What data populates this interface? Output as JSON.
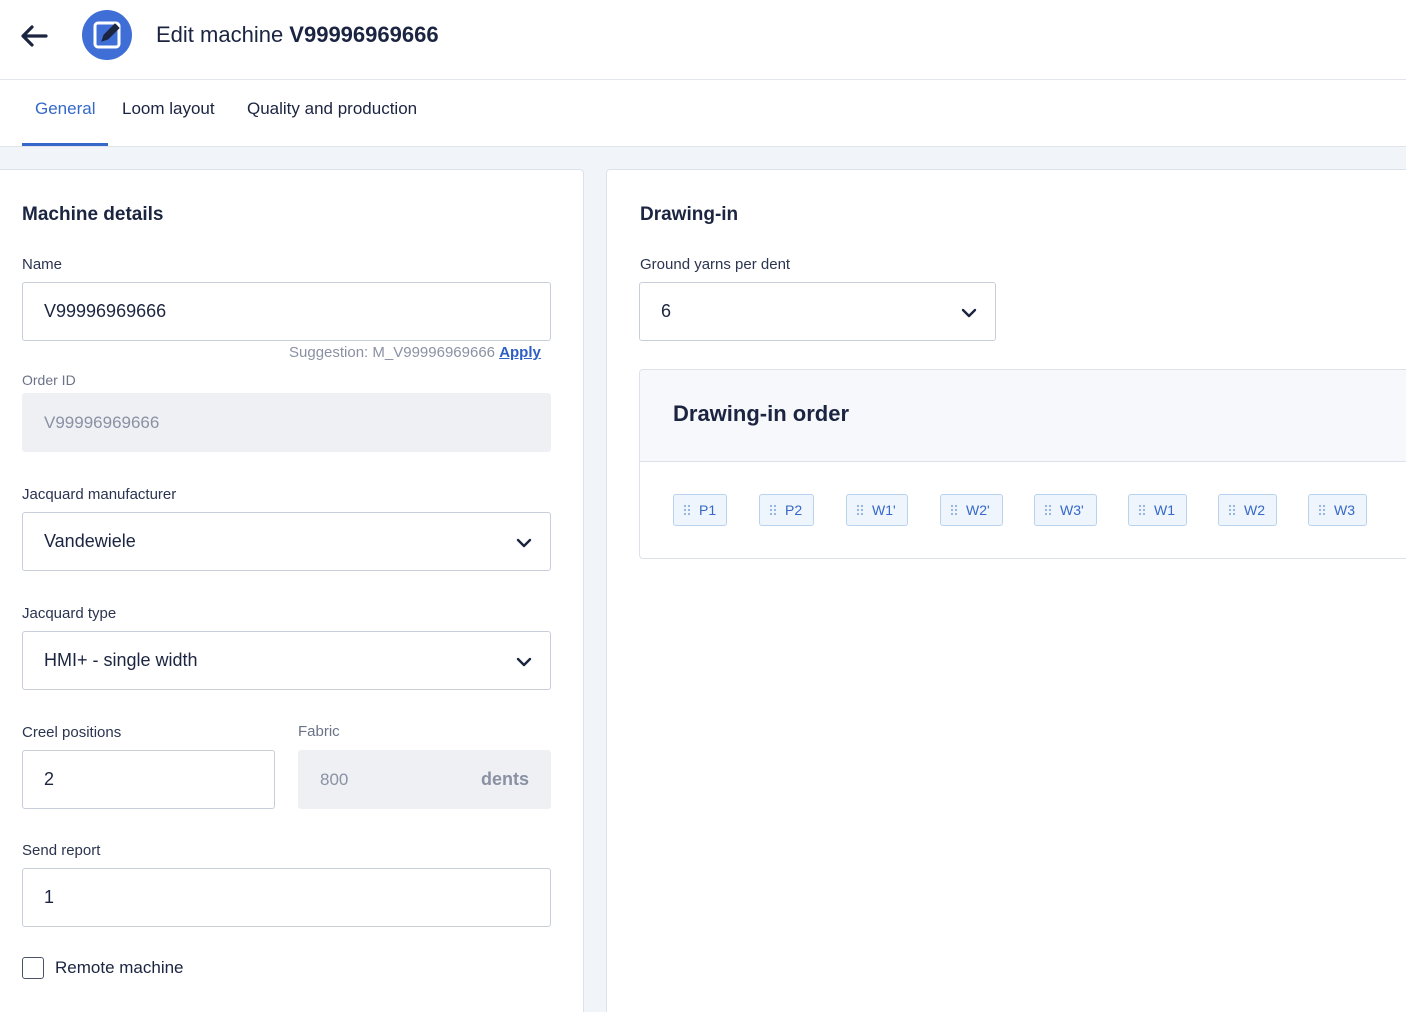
{
  "header": {
    "back_icon": "arrow-left-icon",
    "title_prefix": "Edit machine ",
    "title_machine": "V99996969666",
    "avatar_icon": "edit-square-icon"
  },
  "tabs": [
    {
      "label": "General",
      "active": true
    },
    {
      "label": "Loom layout",
      "active": false
    },
    {
      "label": "Quality and production",
      "active": false
    }
  ],
  "machine_details": {
    "title": "Machine details",
    "name": {
      "label": "Name",
      "value": "V99996969666"
    },
    "suggestion": {
      "text": "Suggestion: M_V99996969666",
      "apply_label": "Apply"
    },
    "order_id": {
      "label": "Order ID",
      "value": "V99996969666"
    },
    "jacquard_manufacturer": {
      "label": "Jacquard manufacturer",
      "value": "Vandewiele"
    },
    "jacquard_type": {
      "label": "Jacquard type",
      "value": "HMI+ - single width"
    },
    "creel_positions": {
      "label": "Creel positions",
      "value": "2"
    },
    "fabric": {
      "label": "Fabric",
      "value": "800",
      "suffix": "dents"
    },
    "send_report": {
      "label": "Send report",
      "value": "1"
    },
    "remote_machine": {
      "label": "Remote machine",
      "checked": false
    }
  },
  "drawing_in": {
    "title": "Drawing-in",
    "ground_yarns": {
      "label": "Ground yarns per dent",
      "value": "6"
    },
    "order": {
      "title": "Drawing-in order",
      "chips": [
        "P1",
        "P2",
        "W1'",
        "W2'",
        "W3'",
        "W1",
        "W2",
        "W3"
      ]
    }
  },
  "colors": {
    "accent": "#3568c8",
    "avatar": "#3f6fd6",
    "text_dark": "#1b2440",
    "background": "#f1f4f8"
  }
}
